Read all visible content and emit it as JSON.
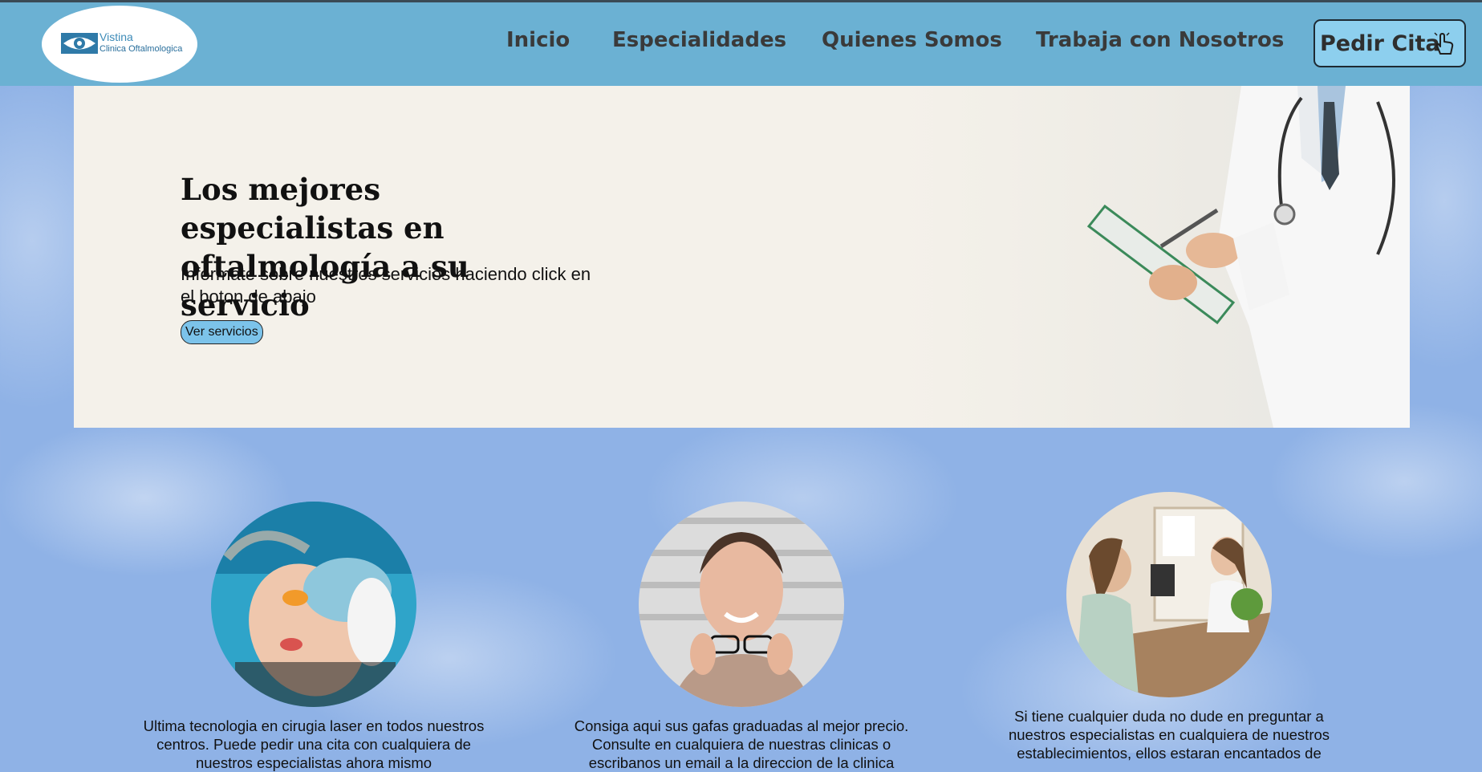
{
  "header": {
    "logo": {
      "name": "Vistina",
      "subtitle": "Clinica Oftalmologica",
      "icon": "eye-icon"
    },
    "nav": [
      "Inicio",
      "Especialidades",
      "Quienes Somos",
      "Trabaja con Nosotros"
    ],
    "cta_label": "Pedir Cita",
    "cta_icon": "pointing-hand-icon"
  },
  "hero": {
    "title": "Los mejores especialistas en oftalmología a su servicio",
    "text": "Informate sobre nuestros servicios haciendo click en el boton de abajo",
    "button_label": "Ver servicios"
  },
  "features": [
    {
      "text": "Ultima tecnologia en cirugia laser en todos nuestros centros. Puede pedir una cita con cualquiera de nuestros especialistas ahora mismo"
    },
    {
      "text": "Consiga aqui sus gafas graduadas al mejor precio. Consulte en cualquiera de nuestras clinicas o escribanos un email a la direccion de la clinica"
    },
    {
      "text": "Si tiene cualquier duda no dude en preguntar a nuestros especialistas en cualquiera de nuestros establecimientos, ellos estaran encantados de"
    }
  ],
  "colors": {
    "header": "#6bb1d3",
    "cta": "#8dcfee",
    "hero_bg": "#f4f1ea",
    "page_bg": "#8fb2e6"
  }
}
